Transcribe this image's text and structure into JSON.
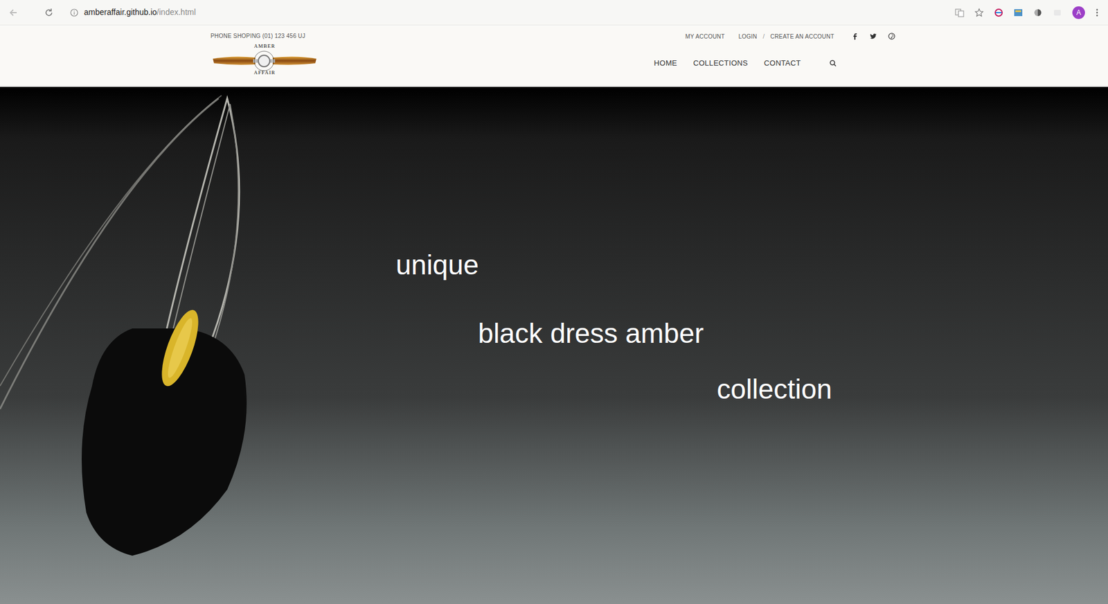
{
  "browser": {
    "url_host": "amberaffair.github.io",
    "url_path": "/index.html",
    "avatar": "A"
  },
  "header": {
    "phone": "PHONE SHOPING (01) 123 456 UJ",
    "logo": {
      "top": "AMBER",
      "bottom": "AFFAIR"
    },
    "account_links": [
      {
        "label": "MY ACCOUNT"
      },
      {
        "label": "LOGIN"
      },
      {
        "label": "CREATE AN ACCOUNT"
      }
    ],
    "separator": "/",
    "nav": [
      {
        "label": "HOME"
      },
      {
        "label": "COLLECTIONS"
      },
      {
        "label": "CONTACT"
      }
    ]
  },
  "hero": {
    "lines": [
      "unique",
      "black dress amber",
      "collection"
    ]
  }
}
